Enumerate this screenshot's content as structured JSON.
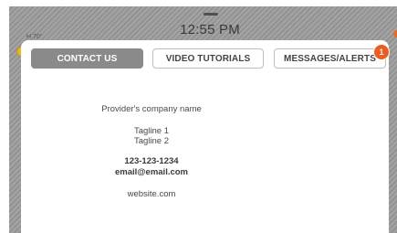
{
  "status_bar": {
    "time": "12:55 PM",
    "weather": "H 70°"
  },
  "tabs": [
    {
      "label": "CONTACT US",
      "active": true
    },
    {
      "label": "VIDEO TUTORIALS",
      "active": false
    },
    {
      "label": "MESSAGES/ALERTS",
      "active": false,
      "badge": "1"
    }
  ],
  "contact": {
    "company": "Provider's company name",
    "tagline1": "Tagline 1",
    "tagline2": "Tagline 2",
    "phone": "123-123-1234",
    "email": "email@email.com",
    "website": "website.com"
  },
  "colors": {
    "active_tab": "#8a8a8a",
    "badge": "#f05a1e",
    "backdrop": "#9a9a9a"
  },
  "icons": {
    "weather": "sun-icon",
    "handle": "drag-handle-icon"
  }
}
